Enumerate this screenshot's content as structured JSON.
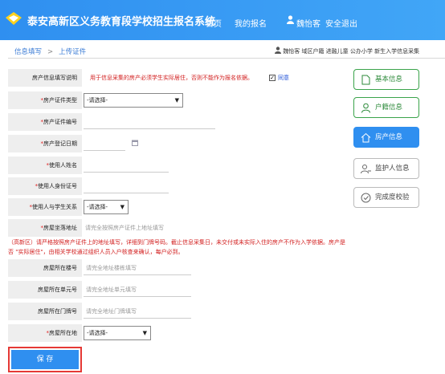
{
  "header": {
    "title": "泰安高新区义务教育段学校招生报名系统",
    "nav": [
      "首页",
      "我的报名",
      "魏怡客",
      "安全退出"
    ]
  },
  "breadcrumb": {
    "step1": "信息填写",
    "sep": ">",
    "step2": "上传证件"
  },
  "user_info": "魏怡客 域区户籍 进融儿童 公办小学 新生入学信息采集",
  "form": {
    "desc_label": "房产信息填写说明",
    "desc_text": "用于信息采集的房产必须学生实际居住，否则不能作为报名依据。",
    "agree": "同意",
    "cert_type_label": "房产证件类型",
    "cert_type_value": "-请选择-",
    "cert_no_label": "房产证件编号",
    "reg_date_label": "房产登记日期",
    "user_name_label": "使用人姓名",
    "user_id_label": "使用人身份证号",
    "relation_label": "使用人与学生关系",
    "relation_value": "-请选择-",
    "address_label": "房屋坐落地址",
    "address_placeholder": "请完全按照房产证件上地址填写",
    "note": "（高新区）请严格按照房产证件上的地址填写，详细到门牌号码。截止信息采集日，未交付或未实际入住的房产不作为入学依据。房产是否 \"实际居住\"，由相关学校通过组织人员入户核查来确认，每户必到。",
    "building_label": "房屋所在楼号",
    "building_placeholder": "请完全地址楼栋填写",
    "unit_label": "房屋所在单元号",
    "unit_placeholder": "请完全地址单元填写",
    "door_label": "房屋所在门牌号",
    "door_placeholder": "请完全地址门牌填写",
    "district_label": "房屋所在地",
    "district_value": "-请选择-",
    "save": "保 存"
  },
  "side": [
    "基本信息",
    "户籍信息",
    "房产信息",
    "监护人信息",
    "完成度校验"
  ],
  "colors": {
    "header": "#2f8ff0",
    "active": "#2f8ff0",
    "green": "#3aa34a",
    "red": "#d21e1e"
  }
}
